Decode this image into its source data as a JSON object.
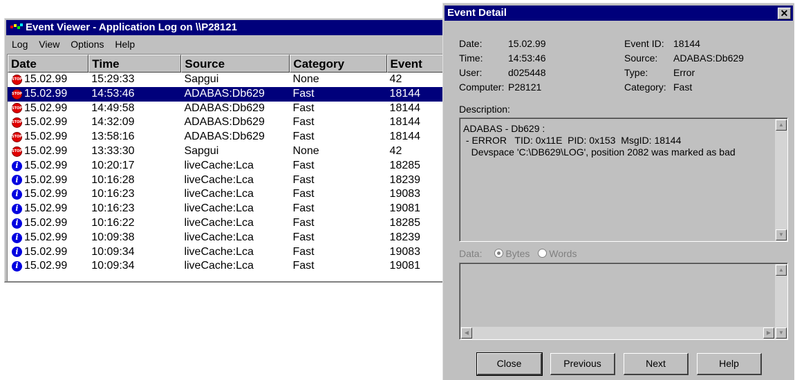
{
  "viewer": {
    "title": "Event Viewer - Application Log on \\\\P28121",
    "menu": [
      "Log",
      "View",
      "Options",
      "Help"
    ],
    "columns": [
      "Date",
      "Time",
      "Source",
      "Category",
      "Event"
    ],
    "rows": [
      {
        "type": "stop-icon",
        "date": "15.02.99",
        "time": "15:29:33",
        "source": "Sapgui",
        "category": "None",
        "event": "42"
      },
      {
        "type": "stop-icon",
        "date": "15.02.99",
        "time": "14:53:46",
        "source": "ADABAS:Db629",
        "category": "Fast",
        "event": "18144",
        "selected": true
      },
      {
        "type": "stop-icon",
        "date": "15.02.99",
        "time": "14:49:58",
        "source": "ADABAS:Db629",
        "category": "Fast",
        "event": "18144"
      },
      {
        "type": "stop-icon",
        "date": "15.02.99",
        "time": "14:32:09",
        "source": "ADABAS:Db629",
        "category": "Fast",
        "event": "18144"
      },
      {
        "type": "stop-icon",
        "date": "15.02.99",
        "time": "13:58:16",
        "source": "ADABAS:Db629",
        "category": "Fast",
        "event": "18144"
      },
      {
        "type": "stop-icon",
        "date": "15.02.99",
        "time": "13:33:30",
        "source": "Sapgui",
        "category": "None",
        "event": "42"
      },
      {
        "type": "info-icon",
        "date": "15.02.99",
        "time": "10:20:17",
        "source": "liveCache:Lca",
        "category": "Fast",
        "event": "18285"
      },
      {
        "type": "info-icon",
        "date": "15.02.99",
        "time": "10:16:28",
        "source": "liveCache:Lca",
        "category": "Fast",
        "event": "18239"
      },
      {
        "type": "info-icon",
        "date": "15.02.99",
        "time": "10:16:23",
        "source": "liveCache:Lca",
        "category": "Fast",
        "event": "19083"
      },
      {
        "type": "info-icon",
        "date": "15.02.99",
        "time": "10:16:23",
        "source": "liveCache:Lca",
        "category": "Fast",
        "event": "19081"
      },
      {
        "type": "info-icon",
        "date": "15.02.99",
        "time": "10:16:22",
        "source": "liveCache:Lca",
        "category": "Fast",
        "event": "18285"
      },
      {
        "type": "info-icon",
        "date": "15.02.99",
        "time": "10:09:38",
        "source": "liveCache:Lca",
        "category": "Fast",
        "event": "18239"
      },
      {
        "type": "info-icon",
        "date": "15.02.99",
        "time": "10:09:34",
        "source": "liveCache:Lca",
        "category": "Fast",
        "event": "19083"
      },
      {
        "type": "info-icon",
        "date": "15.02.99",
        "time": "10:09:34",
        "source": "liveCache:Lca",
        "category": "Fast",
        "event": "19081"
      }
    ]
  },
  "detail": {
    "title": "Event Detail",
    "close_glyph": "✕",
    "labels": {
      "date": "Date:",
      "time": "Time:",
      "user": "User:",
      "computer": "Computer:",
      "event_id": "Event ID:",
      "source": "Source:",
      "type": "Type:",
      "category": "Category:",
      "description": "Description:",
      "data": "Data:",
      "bytes": "Bytes",
      "words": "Words"
    },
    "values": {
      "date": "15.02.99",
      "time": "14:53:46",
      "user": "d025448",
      "computer": "P28121",
      "event_id": "18144",
      "source": "ADABAS:Db629",
      "type": "Error",
      "category": "Fast"
    },
    "description": "ADABAS - Db629 :\n - ERROR   TID: 0x11E  PID: 0x153  MsgID: 18144\n   Devspace 'C:\\DB629\\LOG', position 2082 was marked as bad",
    "buttons": {
      "close": "Close",
      "previous": "Previous",
      "next": "Next",
      "help": "Help"
    }
  },
  "colors": {
    "titlebar": "#00007b",
    "face": "#c0c0c0",
    "selection": "#00007b",
    "stop": "#e00000",
    "info": "#0000e0"
  }
}
